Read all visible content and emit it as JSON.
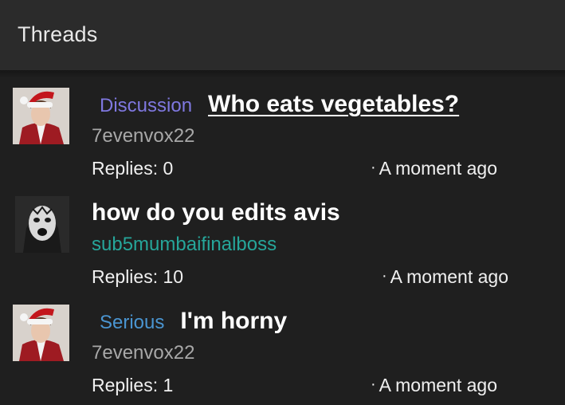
{
  "header": {
    "title": "Threads"
  },
  "threads": [
    {
      "tag": "Discussion",
      "title": "Who eats vegetables?",
      "author": "7evenvox22",
      "replies": "Replies: 0",
      "time": "A moment ago",
      "avatar": "santa-hat-avatar"
    },
    {
      "tag": "",
      "title": "how do you edits avis",
      "author": "sub5mumbaifinalboss",
      "replies": "Replies: 10",
      "time": "A moment ago",
      "avatar": "clown-avatar"
    },
    {
      "tag": "Serious",
      "title": "I'm horny",
      "author": "7evenvox22",
      "replies": "Replies: 1",
      "time": "A moment ago",
      "avatar": "santa-hat-avatar"
    }
  ],
  "colors": {
    "background": "#1f1f1f",
    "header": "#2b2b2b",
    "tag_discussion": "#7f78e0",
    "tag_serious": "#4a95d1",
    "author_teal": "#26a69a"
  }
}
